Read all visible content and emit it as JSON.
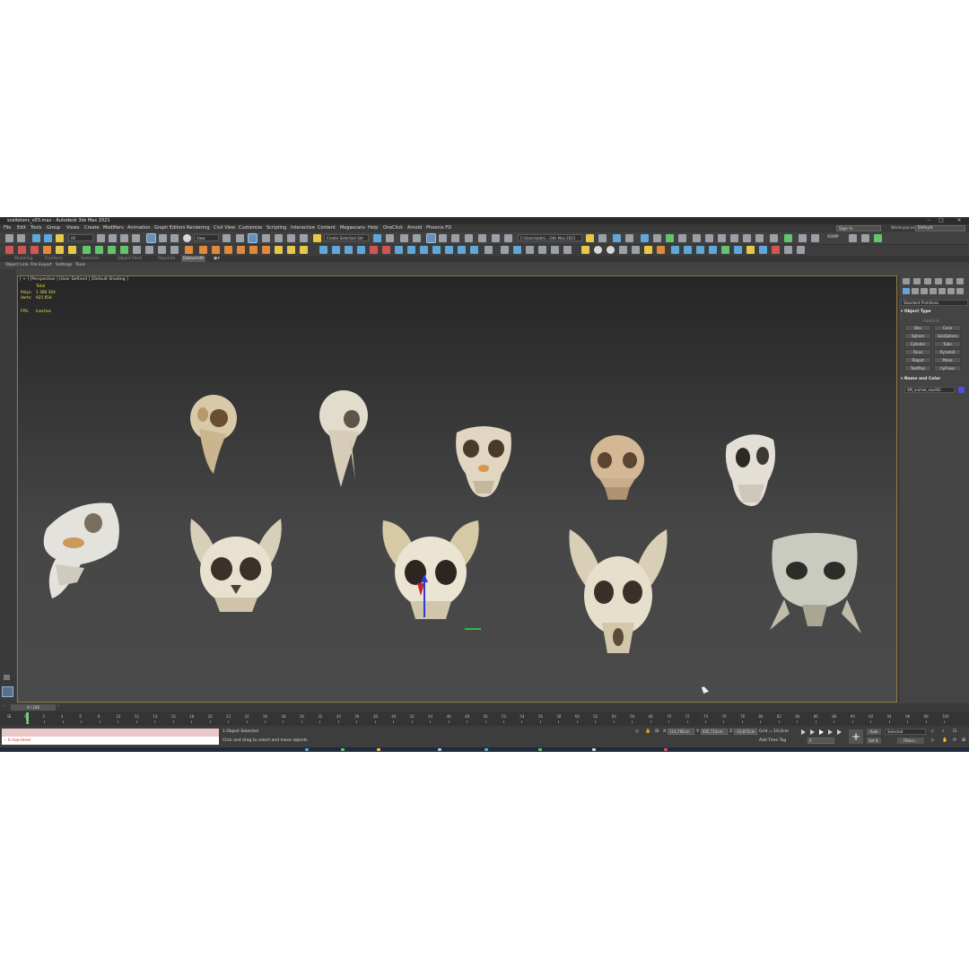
{
  "window": {
    "title": "scelletons_v03.max - Autodesk 3ds Max 2021"
  },
  "menu": [
    "File",
    "Edit",
    "Tools",
    "Group",
    "Views",
    "Create",
    "Modifiers",
    "Animation",
    "Graph Editors",
    "Rendering",
    "Civil View",
    "Customize",
    "Scripting",
    "Interactive",
    "Content",
    "Megascans",
    "Help",
    "OneClick",
    "Arnold",
    "Phoenix FD"
  ],
  "signin": {
    "label": "Sign In"
  },
  "workspaces": {
    "label": "Workspaces:",
    "value": "Default"
  },
  "toolbar": {
    "filter_value": "All",
    "view_value": "View",
    "selection_set": "Create Selection Set",
    "path_value": "C:\\Users\\admi...\\3ds Max 2021",
    "xsmp": "XSMP"
  },
  "ribbon": {
    "tabs": [
      "Modeling",
      "Freeform",
      "Selection",
      "Object Paint",
      "Populate",
      "Datasmith"
    ]
  },
  "subribbon": [
    "Object Link",
    "File Export",
    "Settings",
    "Tools"
  ],
  "viewport": {
    "label": "[ + ] [Perspective ] [User Defined ] [Default Shading ]",
    "stats": {
      "total_label": "Total",
      "polys_label": "Polys:",
      "polys_value": "1 386 304",
      "verts_label": "Verts:",
      "verts_value": "925 654",
      "fps_label": "FPS:",
      "fps_value": "Inactive"
    }
  },
  "command_panel": {
    "primitive_type": "Standard Primitives",
    "object_type_title": "Object Type",
    "autogrid": "AutoGrid",
    "buttons": [
      "Box",
      "Cone",
      "Sphere",
      "GeoSphere",
      "Cylinder",
      "Tube",
      "Torus",
      "Pyramid",
      "Teapot",
      "Plane",
      "TextPlus",
      "hyFluxe"
    ],
    "name_color_title": "Name and Color",
    "object_name": "SM_animal_skull02",
    "object_color": "#4f4fd8"
  },
  "timeline": {
    "frame_readout": "0 / 100",
    "ticks": [
      "0",
      "2",
      "4",
      "6",
      "8",
      "10",
      "12",
      "14",
      "16",
      "18",
      "20",
      "22",
      "24",
      "26",
      "28",
      "30",
      "32",
      "34",
      "36",
      "38",
      "40",
      "42",
      "44",
      "46",
      "48",
      "50",
      "52",
      "54",
      "56",
      "58",
      "60",
      "62",
      "64",
      "66",
      "68",
      "70",
      "72",
      "74",
      "76",
      "78",
      "80",
      "82",
      "84",
      "86",
      "88",
      "90",
      "92",
      "94",
      "96",
      "98",
      "100"
    ]
  },
  "status": {
    "listener_text": "-- In top-level",
    "selection": "1 Object Selected",
    "prompt": "Click and drag to select and move objects",
    "x_label": "X:",
    "x_value": "114,785cm",
    "y_label": "Y:",
    "y_value": "935,714cm",
    "z_label": "Z:",
    "z_value": "-10,872cm",
    "grid": "Grid = 10,0cm",
    "add_time_tag": "Add Time Tag",
    "auto": "Auto",
    "set_k": "Set K.",
    "selected": "Selected",
    "filters": "Filters...",
    "frame_field": "0"
  }
}
